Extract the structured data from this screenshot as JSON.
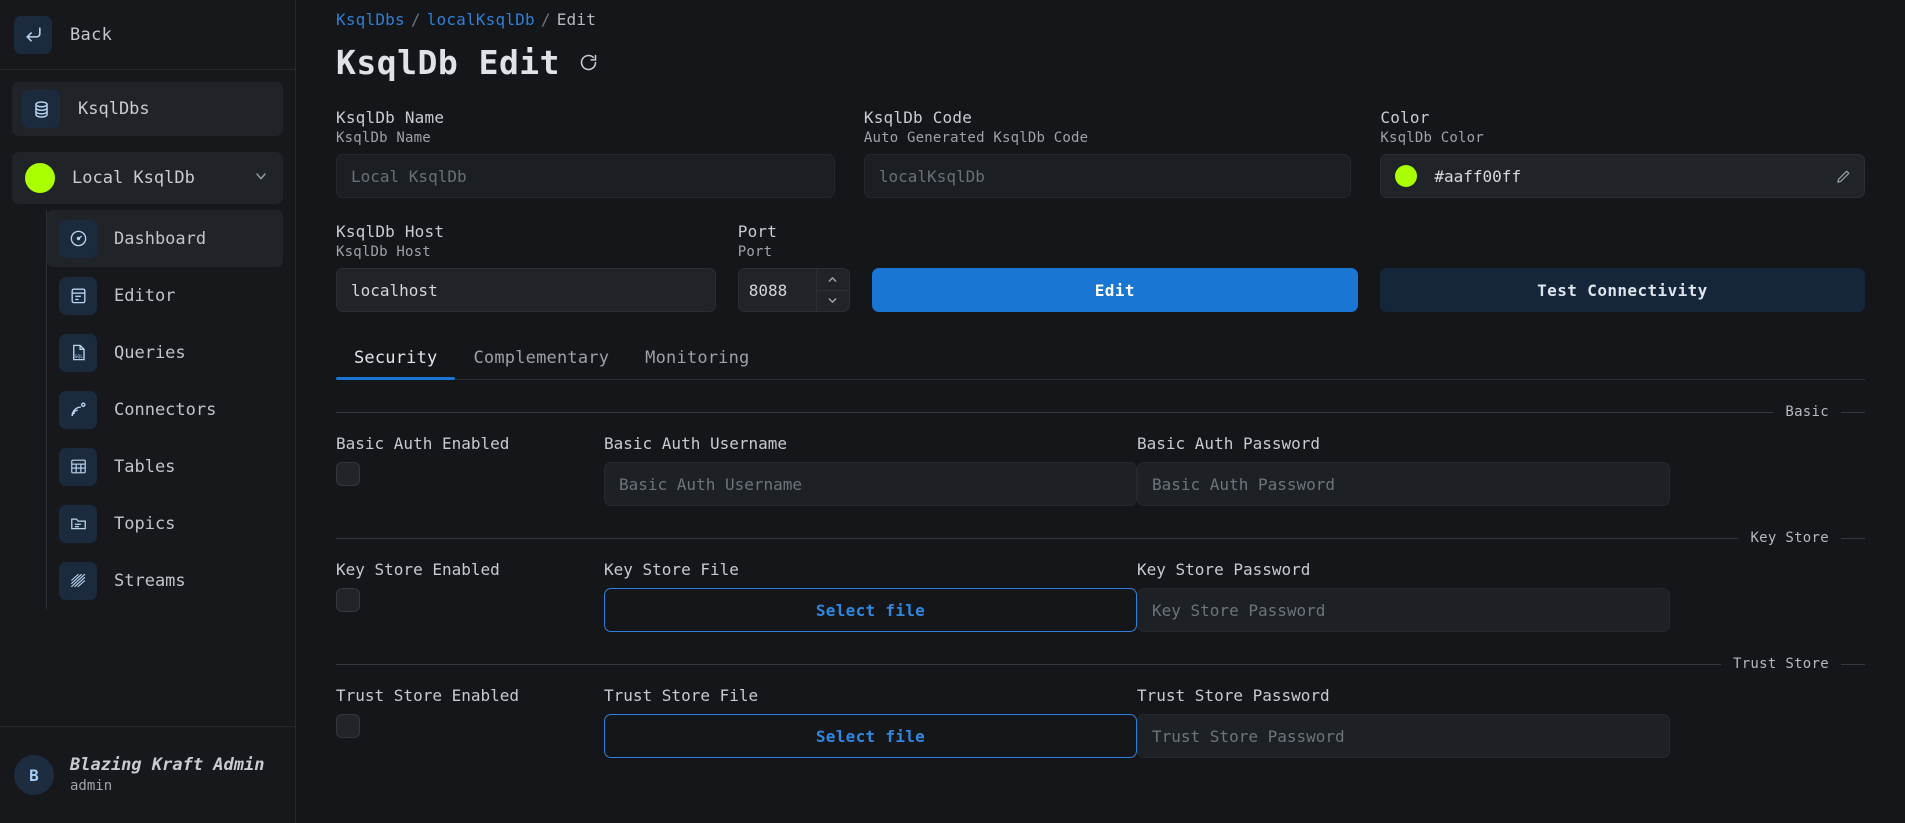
{
  "sidebar": {
    "back_label": "Back",
    "back_icon": "arrow-back-icon",
    "nav_top": {
      "label": "KsqlDbs",
      "icon": "database-icon"
    },
    "cluster": {
      "label": "Local KsqlDb",
      "color": "#aaff00",
      "chevron": "chevron-down-icon"
    },
    "items": [
      {
        "label": "Dashboard",
        "icon": "gauge-icon",
        "active": true
      },
      {
        "label": "Editor",
        "icon": "clipboard-icon",
        "active": false
      },
      {
        "label": "Queries",
        "icon": "sql-file-icon",
        "active": false
      },
      {
        "label": "Connectors",
        "icon": "connector-icon",
        "active": false
      },
      {
        "label": "Tables",
        "icon": "table-icon",
        "active": false
      },
      {
        "label": "Topics",
        "icon": "folder-icon",
        "active": false
      },
      {
        "label": "Streams",
        "icon": "streams-icon",
        "active": false
      }
    ],
    "user": {
      "initial": "B",
      "name": "Blazing Kraft Admin",
      "role": "admin"
    }
  },
  "header": {
    "breadcrumb": {
      "root": "KsqlDbs",
      "mid": "localKsqlDb",
      "current": "Edit",
      "separator": "/"
    },
    "title": "KsqlDb Edit",
    "refresh_icon": "refresh-icon"
  },
  "form": {
    "name": {
      "label": "KsqlDb Name",
      "sublabel": "KsqlDb Name",
      "placeholder": "Local KsqlDb",
      "value": ""
    },
    "code": {
      "label": "KsqlDb Code",
      "sublabel": "Auto Generated KsqlDb Code",
      "placeholder": "localKsqlDb",
      "value": ""
    },
    "color": {
      "label": "Color",
      "sublabel": "KsqlDb Color",
      "value": "#aaff00ff",
      "swatch": "#aaff00",
      "edit_icon": "pencil-icon"
    },
    "host": {
      "label": "KsqlDb Host",
      "sublabel": "KsqlDb Host",
      "value": "localhost",
      "placeholder": "KsqlDb Host"
    },
    "port": {
      "label": "Port",
      "sublabel": "Port",
      "value": "8088",
      "placeholder": "Port",
      "up_icon": "chevron-up-icon",
      "down_icon": "chevron-down-icon"
    },
    "edit_button": "Edit",
    "test_button": "Test Connectivity"
  },
  "tabs": [
    {
      "label": "Security",
      "active": true
    },
    {
      "label": "Complementary",
      "active": false
    },
    {
      "label": "Monitoring",
      "active": false
    }
  ],
  "sections": {
    "basic": {
      "legend": "Basic",
      "enabled_label": "Basic Auth Enabled",
      "username_label": "Basic Auth Username",
      "username_placeholder": "Basic Auth Username",
      "password_label": "Basic Auth Password",
      "password_placeholder": "Basic Auth Password"
    },
    "key_store": {
      "legend": "Key Store",
      "enabled_label": "Key Store Enabled",
      "file_label": "Key Store File",
      "file_button": "Select file",
      "password_label": "Key Store Password",
      "password_placeholder": "Key Store Password"
    },
    "trust_store": {
      "legend": "Trust Store",
      "enabled_label": "Trust Store Enabled",
      "file_label": "Trust Store File",
      "file_button": "Select file",
      "password_label": "Trust Store Password",
      "password_placeholder": "Trust Store Password"
    }
  },
  "colors": {
    "accent": "#1976d2",
    "brand_green": "#aaff00",
    "link": "#2f7fd4"
  }
}
